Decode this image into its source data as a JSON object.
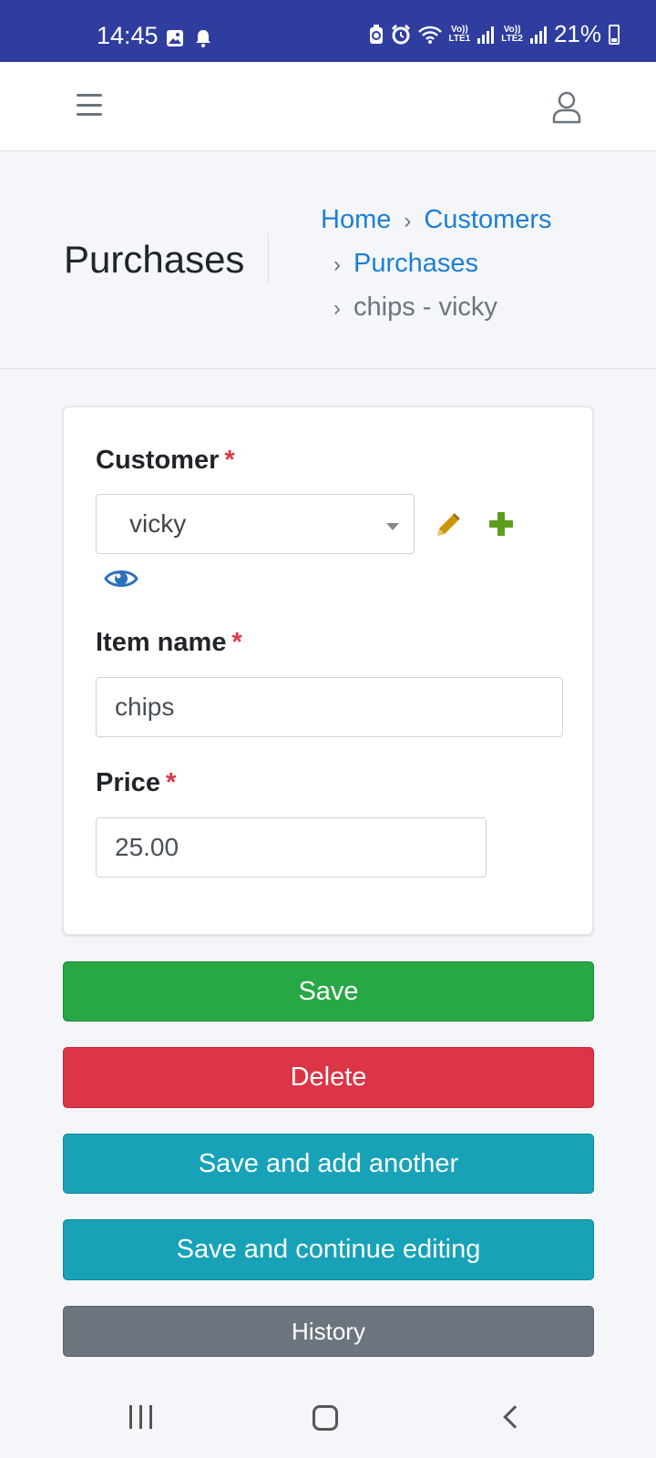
{
  "status_bar": {
    "time": "14:45",
    "battery": "21%",
    "sim1_label": "Vo))\nLTE1",
    "sim2_label": "Vo))\nLTE2",
    "icons": [
      "image-icon",
      "bell-icon",
      "data-saver-icon",
      "alarm-icon",
      "wifi-icon",
      "signal-icon",
      "battery-icon"
    ]
  },
  "navbar": {
    "menu_icon": "hamburger-icon",
    "user_icon": "user-icon"
  },
  "header": {
    "title": "Purchases",
    "breadcrumb": {
      "home": "Home",
      "customers": "Customers",
      "purchases": "Purchases",
      "current": "chips - vicky",
      "separator": "›"
    }
  },
  "form": {
    "customer": {
      "label": "Customer",
      "required_mark": "*",
      "value": "vicky",
      "edit_icon": "pencil-icon",
      "add_icon": "plus-icon",
      "view_icon": "eye-icon"
    },
    "item_name": {
      "label": "Item name",
      "required_mark": "*",
      "value": "chips"
    },
    "price": {
      "label": "Price",
      "required_mark": "*",
      "value": "25.00"
    }
  },
  "actions": {
    "save": "Save",
    "delete": "Delete",
    "save_add": "Save and add another",
    "save_continue": "Save and continue editing",
    "history": "History"
  },
  "colors": {
    "status_bar": "#2f3d9e",
    "link": "#1b7fd4",
    "required": "#dc3545",
    "success": "#28a745",
    "danger": "#dc3545",
    "info": "#17a2b8",
    "secondary": "#6c757d",
    "edit_icon": "#c8960c",
    "add_icon": "#5a9e1c",
    "view_icon": "#2d6fbf"
  },
  "system_nav": {
    "recents": "recents-icon",
    "home": "home-icon",
    "back": "back-icon"
  }
}
